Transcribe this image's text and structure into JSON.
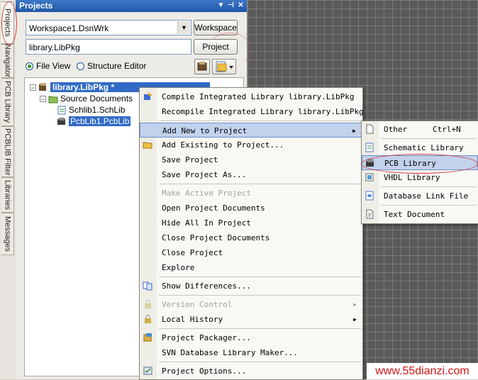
{
  "side_tabs": [
    "Projects",
    "Navigator",
    "PCB Library",
    "PCBLIB Filter",
    "Libraries",
    "Messages"
  ],
  "panel": {
    "title": "Projects",
    "workspace_value": "Workspace1.DsnWrk",
    "workspace_button": "Workspace",
    "project_value": "library.LibPkg",
    "project_button": "Project",
    "view_file": "File View",
    "view_structure": "Structure Editor"
  },
  "tree": {
    "root": "library.LibPkg *",
    "folder": "Source Documents",
    "doc1": "Schlib1.SchLib",
    "doc2": "PcbLib1.PcbLib"
  },
  "menu": {
    "items": [
      "Compile Integrated Library library.LibPkg",
      "Recompile Integrated Library library.LibPkg",
      "Add New to Project",
      "Add Existing to Project...",
      "Save Project",
      "Save Project As...",
      "Make Active Project",
      "Open Project Documents",
      "Hide All In Project",
      "Close Project Documents",
      "Close Project",
      "Explore",
      "Show Differences...",
      "Version Control",
      "Local History",
      "Project Packager...",
      "SVN Database Library Maker...",
      "Project Options..."
    ]
  },
  "submenu": {
    "items": [
      "Other",
      "Schematic Library",
      "PCB Library",
      "VHDL Library",
      "Database Link File",
      "Text Document"
    ],
    "other_shortcut": "Ctrl+N"
  },
  "watermark": "www.55dianzi.com",
  "colors": {
    "highlight": "#c2d2ec",
    "selection": "#316ac5",
    "annotation_red": "#d23b3b",
    "title_bar": "#2a62b4"
  }
}
